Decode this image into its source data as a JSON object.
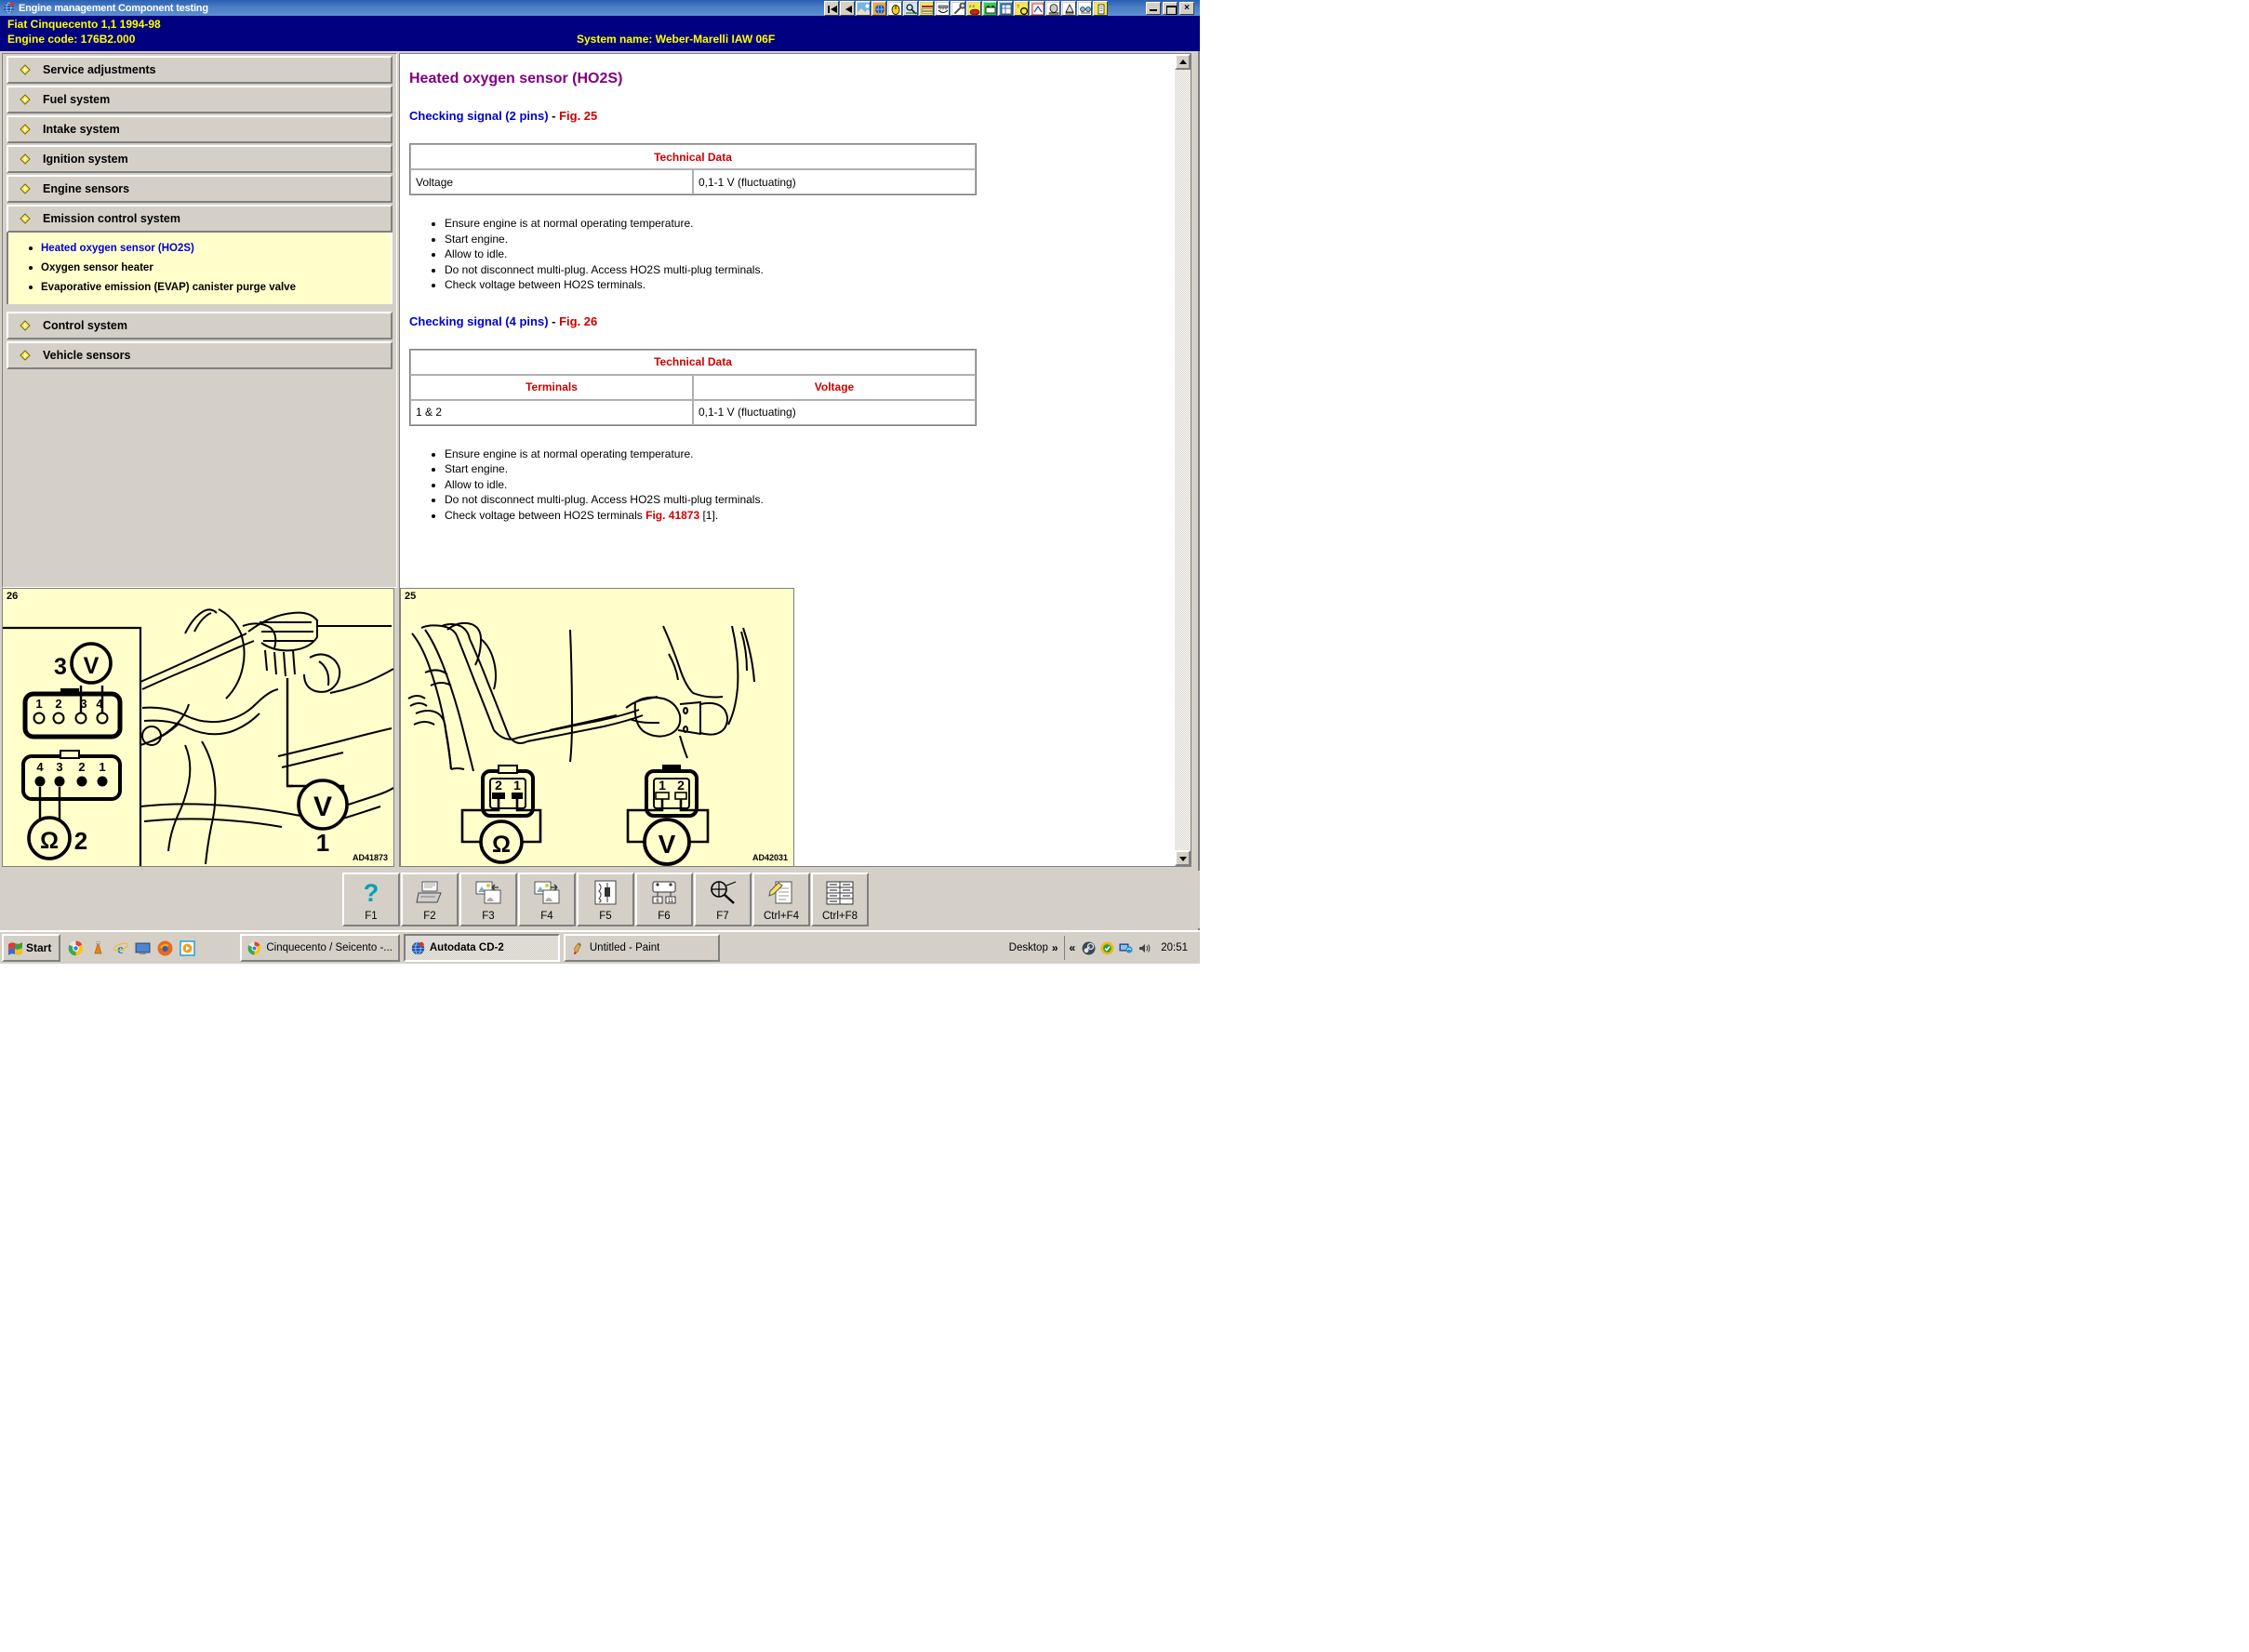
{
  "window": {
    "title": "Engine management Component testing",
    "app_icon": "autodata-globe-icon",
    "controls": {
      "minimize": "_",
      "maximize": "□",
      "close": "×"
    },
    "toolbar_icons": [
      "first-record-icon",
      "previous-record-icon",
      "vehicle-photo-icon",
      "globe-icon",
      "mouse-icon",
      "search-vehicle-icon",
      "wiring-diagram-icon",
      "engine-layout-icon",
      "spanner-icon",
      "tyre-data-icon",
      "battery-icon",
      "service-schedule-icon",
      "timing-belt-icon",
      "component-testing-icon",
      "airbag-icon",
      "glow-plug-icon",
      "key-programming-icon",
      "notes-icon"
    ]
  },
  "header": {
    "make_model": "Fiat   Cinquecento 1,1  1994-98",
    "engine_code": "Engine code: 176B2.000",
    "system_name": "System name: Weber-Marelli IAW 06F"
  },
  "sidebar": {
    "items": [
      {
        "label": "Service adjustments",
        "icon": "diamond-right-icon",
        "expanded": false
      },
      {
        "label": "Fuel system",
        "icon": "diamond-right-icon",
        "expanded": false
      },
      {
        "label": "Intake system",
        "icon": "diamond-right-icon",
        "expanded": false
      },
      {
        "label": "Ignition system",
        "icon": "diamond-right-icon",
        "expanded": false
      },
      {
        "label": "Engine sensors",
        "icon": "diamond-right-icon",
        "expanded": false
      },
      {
        "label": "Emission control system",
        "icon": "diamond-down-icon",
        "expanded": true
      },
      {
        "label": "Control system",
        "icon": "diamond-right-icon",
        "expanded": false
      },
      {
        "label": "Vehicle sensors",
        "icon": "diamond-right-icon",
        "expanded": false
      }
    ],
    "sub_items": [
      {
        "label": "Heated oxygen sensor (HO2S)",
        "selected": true
      },
      {
        "label": "Oxygen sensor heater",
        "selected": false
      },
      {
        "label": "Evaporative emission (EVAP) canister purge valve",
        "selected": false
      }
    ]
  },
  "content": {
    "title": "Heated oxygen sensor (HO2S)",
    "sections": [
      {
        "heading": "Checking signal (2 pins)",
        "separator": " - ",
        "fig": "Fig. 25",
        "table": {
          "caption": "Technical Data",
          "has_column_headers": false,
          "rows": [
            [
              "Voltage",
              "0,1-1 V (fluctuating)"
            ]
          ]
        },
        "steps": [
          {
            "text": "Ensure engine is at normal operating temperature."
          },
          {
            "text": "Start engine."
          },
          {
            "text": "Allow to idle."
          },
          {
            "text": "Do not disconnect multi-plug. Access HO2S multi-plug terminals."
          },
          {
            "text": "Check voltage between HO2S terminals."
          }
        ]
      },
      {
        "heading": "Checking signal (4 pins)",
        "separator": " - ",
        "fig": "Fig. 26",
        "table": {
          "caption": "Technical Data",
          "has_column_headers": true,
          "columns": [
            "Terminals",
            "Voltage"
          ],
          "rows": [
            [
              "1 & 2",
              "0,1-1 V (fluctuating)"
            ]
          ]
        },
        "steps": [
          {
            "text": "Ensure engine is at normal operating temperature."
          },
          {
            "text": "Start engine."
          },
          {
            "text": "Allow to idle."
          },
          {
            "text": "Do not disconnect multi-plug. Access HO2S multi-plug terminals."
          },
          {
            "text": "Check voltage between HO2S terminals ",
            "link": "Fig. 41873",
            "tail": " [1]."
          }
        ]
      }
    ]
  },
  "figures": [
    {
      "number": "26",
      "code": "AD41873",
      "callouts": [
        "3",
        "2",
        "1"
      ],
      "connector_top_pins": [
        "1",
        "2",
        "3",
        "4"
      ],
      "connector_bottom_pins": [
        "4",
        "3",
        "2",
        "1"
      ],
      "meters": [
        "V",
        "Ω",
        "V"
      ]
    },
    {
      "number": "25",
      "code": "AD42031",
      "connector_left_pins": [
        "2",
        "1"
      ],
      "connector_right_pins": [
        "1",
        "2"
      ],
      "meters": [
        "Ω",
        "V"
      ]
    }
  ],
  "function_bar": {
    "keys": [
      {
        "cap": "F1",
        "icon": "help-question-icon"
      },
      {
        "cap": "F2",
        "icon": "printer-icon"
      },
      {
        "cap": "F3",
        "icon": "previous-image-icon"
      },
      {
        "cap": "F4",
        "icon": "next-image-icon"
      },
      {
        "cap": "F5",
        "icon": "wiring-diagram-icon"
      },
      {
        "cap": "F6",
        "icon": "component-location-icon"
      },
      {
        "cap": "F7",
        "icon": "zoom-tool-icon"
      },
      {
        "cap": "Ctrl+F4",
        "icon": "notes-pencil-icon"
      },
      {
        "cap": "Ctrl+F8",
        "icon": "table-grid-icon"
      }
    ]
  },
  "taskbar": {
    "start_label": "Start",
    "quick_launch": [
      "chrome-icon",
      "vlc-icon",
      "internet-explorer-icon",
      "show-desktop-icon",
      "firefox-icon",
      "media-player-icon"
    ],
    "tasks": [
      {
        "label": "Cinquecento / Seicento -...",
        "icon": "chrome-icon",
        "active": false
      },
      {
        "label": "Autodata CD-2",
        "icon": "autodata-globe-icon",
        "active": true
      },
      {
        "label": "Untitled - Paint",
        "icon": "paint-icon",
        "active": false
      }
    ],
    "desktop_label": "Desktop",
    "overflow_chevron": "»",
    "tray_chevron": "«",
    "tray_icons": [
      "steam-icon",
      "antivirus-shield-icon",
      "network-icon",
      "volume-icon"
    ],
    "clock": "20:51"
  },
  "colors": {
    "titlebar": "#2b5fb3",
    "header_band": "#000080",
    "header_text": "#ffff00",
    "face": "#d4d0c8",
    "title_purple": "#800080",
    "heading_blue": "#0000cc",
    "fig_red": "#cc0000",
    "panel_cream": "#ffffcc"
  }
}
